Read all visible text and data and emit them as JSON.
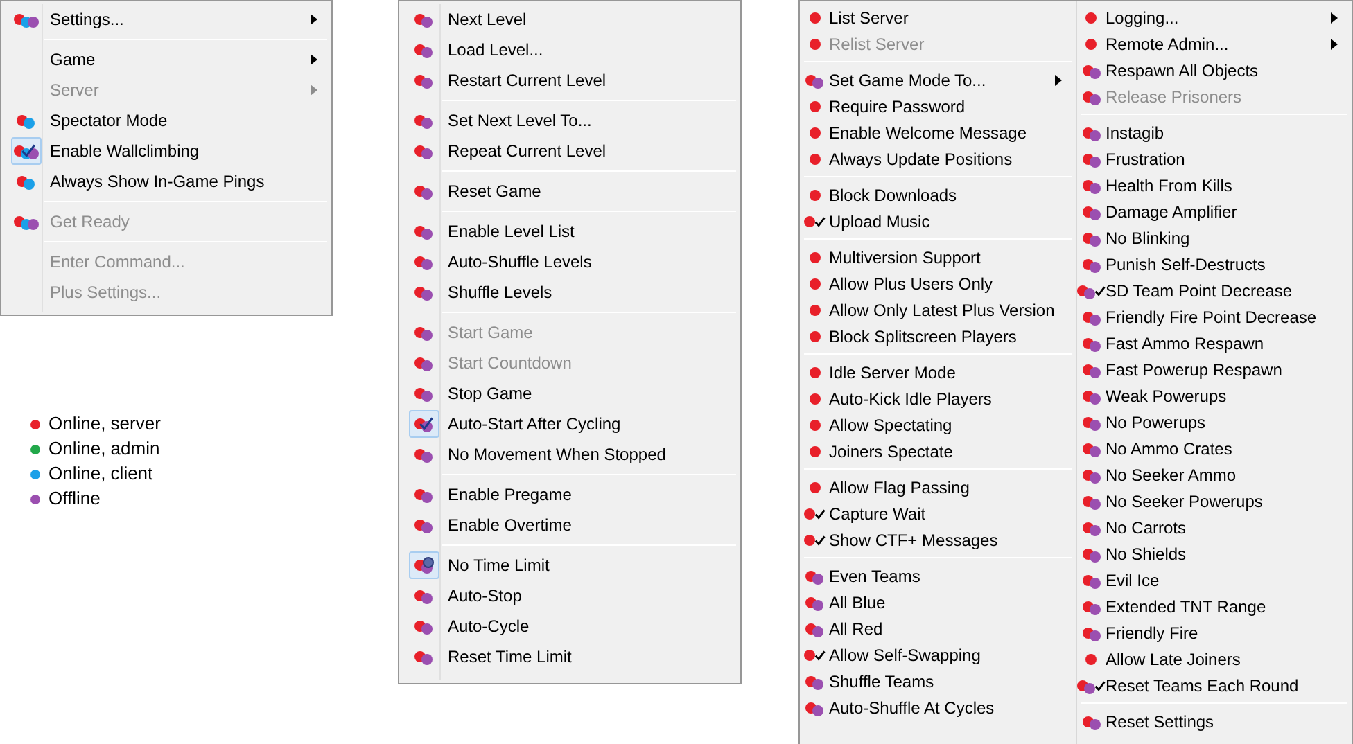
{
  "menus": [
    {
      "kind": "boxed",
      "columns": [
        {
          "sections": [
            [
              {
                "label": "Settings...",
                "dots": [
                  {
                    "color": "#e8202a"
                  },
                  {
                    "color": "#1ba0e8"
                  },
                  {
                    "color": "#9b4fb0"
                  }
                ],
                "checked": false,
                "disabled": false,
                "submenu": true
              }
            ],
            [
              {
                "label": "Game",
                "checked": false,
                "disabled": false,
                "submenu": true
              },
              {
                "label": "Server",
                "checked": false,
                "disabled": true,
                "submenu": true
              },
              {
                "label": "Spectator Mode",
                "dots": [
                  {
                    "color": "#e8202a"
                  },
                  {
                    "color": "#1ba0e8"
                  }
                ],
                "checked": false,
                "disabled": false,
                "submenu": false
              },
              {
                "label": "Enable Wallclimbing",
                "dots": [
                  {
                    "color": "#e8202a"
                  },
                  {
                    "color": "#1ba0e8"
                  },
                  {
                    "color": "#9b4fb0"
                  }
                ],
                "checked": true,
                "disabled": false,
                "submenu": false
              },
              {
                "label": "Always Show In-Game Pings",
                "dots": [
                  {
                    "color": "#e8202a"
                  },
                  {
                    "color": "#1ba0e8"
                  }
                ],
                "checked": false,
                "disabled": false,
                "submenu": false
              }
            ],
            [
              {
                "label": "Get Ready",
                "dots": [
                  {
                    "color": "#e8202a"
                  },
                  {
                    "color": "#1ba0e8"
                  },
                  {
                    "color": "#9b4fb0"
                  }
                ],
                "checked": false,
                "disabled": true,
                "submenu": false
              }
            ],
            [
              {
                "label": "Enter Command...",
                "checked": false,
                "disabled": true,
                "submenu": false
              },
              {
                "label": "Plus Settings...",
                "checked": false,
                "disabled": true,
                "submenu": false
              }
            ]
          ]
        }
      ]
    },
    {
      "kind": "boxed",
      "columns": [
        {
          "sections": [
            [
              {
                "label": "Next Level",
                "dots": [
                  {
                    "color": "#e8202a"
                  },
                  {
                    "color": "#9b4fb0"
                  }
                ],
                "checked": false,
                "disabled": false,
                "kind": "check"
              },
              {
                "label": "Load Level...",
                "dots": [
                  {
                    "color": "#e8202a"
                  },
                  {
                    "color": "#9b4fb0"
                  }
                ],
                "checked": false,
                "disabled": false,
                "kind": "check"
              },
              {
                "label": "Restart Current Level",
                "dots": [
                  {
                    "color": "#e8202a"
                  },
                  {
                    "color": "#9b4fb0"
                  }
                ],
                "checked": false,
                "disabled": false,
                "kind": "check"
              }
            ],
            [
              {
                "label": "Set Next Level To...",
                "dots": [
                  {
                    "color": "#e8202a"
                  },
                  {
                    "color": "#9b4fb0"
                  }
                ],
                "checked": false,
                "disabled": false,
                "kind": "check"
              },
              {
                "label": "Repeat Current Level",
                "dots": [
                  {
                    "color": "#e8202a"
                  },
                  {
                    "color": "#9b4fb0"
                  }
                ],
                "checked": false,
                "disabled": false,
                "kind": "check"
              }
            ],
            [
              {
                "label": "Reset Game",
                "dots": [
                  {
                    "color": "#e8202a"
                  },
                  {
                    "color": "#9b4fb0"
                  }
                ],
                "checked": false,
                "disabled": false,
                "kind": "check"
              }
            ],
            [
              {
                "label": "Enable Level List",
                "dots": [
                  {
                    "color": "#e8202a"
                  },
                  {
                    "color": "#9b4fb0"
                  }
                ],
                "checked": false,
                "disabled": false,
                "kind": "check"
              },
              {
                "label": "Auto-Shuffle Levels",
                "dots": [
                  {
                    "color": "#e8202a"
                  },
                  {
                    "color": "#9b4fb0"
                  }
                ],
                "checked": false,
                "disabled": false,
                "kind": "check"
              },
              {
                "label": "Shuffle Levels",
                "dots": [
                  {
                    "color": "#e8202a"
                  },
                  {
                    "color": "#9b4fb0"
                  }
                ],
                "checked": false,
                "disabled": false,
                "kind": "check"
              }
            ],
            [
              {
                "label": "Start Game",
                "dots": [
                  {
                    "color": "#e8202a"
                  },
                  {
                    "color": "#9b4fb0"
                  }
                ],
                "checked": false,
                "disabled": true,
                "kind": "check"
              },
              {
                "label": "Start Countdown",
                "dots": [
                  {
                    "color": "#e8202a"
                  },
                  {
                    "color": "#9b4fb0"
                  }
                ],
                "checked": false,
                "disabled": true,
                "kind": "check"
              },
              {
                "label": "Stop Game",
                "dots": [
                  {
                    "color": "#e8202a"
                  },
                  {
                    "color": "#9b4fb0"
                  }
                ],
                "checked": false,
                "disabled": false,
                "kind": "check"
              },
              {
                "label": "Auto-Start After Cycling",
                "dots": [
                  {
                    "color": "#e8202a"
                  },
                  {
                    "color": "#9b4fb0"
                  }
                ],
                "checked": true,
                "disabled": false,
                "kind": "check"
              },
              {
                "label": "No Movement When Stopped",
                "dots": [
                  {
                    "color": "#e8202a"
                  },
                  {
                    "color": "#9b4fb0"
                  }
                ],
                "checked": false,
                "disabled": false,
                "kind": "check"
              }
            ],
            [
              {
                "label": "Enable Pregame",
                "dots": [
                  {
                    "color": "#e8202a"
                  },
                  {
                    "color": "#9b4fb0"
                  }
                ],
                "checked": false,
                "disabled": false,
                "kind": "check"
              },
              {
                "label": "Enable Overtime",
                "dots": [
                  {
                    "color": "#e8202a"
                  },
                  {
                    "color": "#9b4fb0"
                  }
                ],
                "checked": false,
                "disabled": false,
                "kind": "check"
              }
            ],
            [
              {
                "label": "No Time Limit",
                "dots": [
                  {
                    "color": "#e8202a"
                  },
                  {
                    "color": "#9b4fb0"
                  }
                ],
                "checked": true,
                "disabled": false,
                "kind": "radio"
              },
              {
                "label": "Auto-Stop",
                "dots": [
                  {
                    "color": "#e8202a"
                  },
                  {
                    "color": "#9b4fb0"
                  }
                ],
                "checked": false,
                "disabled": false,
                "kind": "check"
              },
              {
                "label": "Auto-Cycle",
                "dots": [
                  {
                    "color": "#e8202a"
                  },
                  {
                    "color": "#9b4fb0"
                  }
                ],
                "checked": false,
                "disabled": false,
                "kind": "check"
              },
              {
                "label": "Reset Time Limit",
                "dots": [
                  {
                    "color": "#e8202a"
                  },
                  {
                    "color": "#9b4fb0"
                  }
                ],
                "checked": false,
                "disabled": false,
                "kind": "check"
              }
            ]
          ]
        }
      ]
    },
    {
      "kind": "plain",
      "columns": [
        {
          "sections": [
            [
              {
                "label": "List Server",
                "dots": [
                  {
                    "color": "#e8202a"
                  }
                ],
                "checked": false,
                "disabled": false,
                "submenu": false
              },
              {
                "label": "Relist Server",
                "dots": [
                  {
                    "color": "#e8202a"
                  }
                ],
                "checked": false,
                "disabled": true,
                "submenu": false
              }
            ],
            [
              {
                "label": "Set Game Mode To...",
                "dots": [
                  {
                    "color": "#e8202a"
                  },
                  {
                    "color": "#9b4fb0"
                  }
                ],
                "checked": false,
                "disabled": false,
                "submenu": true
              },
              {
                "label": "Require Password",
                "dots": [
                  {
                    "color": "#e8202a"
                  }
                ],
                "checked": false,
                "disabled": false,
                "submenu": false
              },
              {
                "label": "Enable Welcome Message",
                "dots": [
                  {
                    "color": "#e8202a"
                  }
                ],
                "checked": false,
                "disabled": false,
                "submenu": false
              },
              {
                "label": "Always Update Positions",
                "dots": [
                  {
                    "color": "#e8202a"
                  }
                ],
                "checked": false,
                "disabled": false,
                "submenu": false
              }
            ],
            [
              {
                "label": "Block Downloads",
                "dots": [
                  {
                    "color": "#e8202a"
                  }
                ],
                "checked": false,
                "disabled": false,
                "submenu": false
              },
              {
                "label": "Upload Music",
                "dots": [
                  {
                    "color": "#e8202a"
                  }
                ],
                "checked": true,
                "disabled": false,
                "submenu": false
              }
            ],
            [
              {
                "label": "Multiversion Support",
                "dots": [
                  {
                    "color": "#e8202a"
                  }
                ],
                "checked": false,
                "disabled": false,
                "submenu": false
              },
              {
                "label": "Allow Plus Users Only",
                "dots": [
                  {
                    "color": "#e8202a"
                  }
                ],
                "checked": false,
                "disabled": false,
                "submenu": false
              },
              {
                "label": "Allow Only Latest Plus Version",
                "dots": [
                  {
                    "color": "#e8202a"
                  }
                ],
                "checked": false,
                "disabled": false,
                "submenu": false
              },
              {
                "label": "Block Splitscreen Players",
                "dots": [
                  {
                    "color": "#e8202a"
                  }
                ],
                "checked": false,
                "disabled": false,
                "submenu": false
              }
            ],
            [
              {
                "label": "Idle Server Mode",
                "dots": [
                  {
                    "color": "#e8202a"
                  }
                ],
                "checked": false,
                "disabled": false,
                "submenu": false
              },
              {
                "label": "Auto-Kick Idle Players",
                "dots": [
                  {
                    "color": "#e8202a"
                  }
                ],
                "checked": false,
                "disabled": false,
                "submenu": false
              },
              {
                "label": "Allow Spectating",
                "dots": [
                  {
                    "color": "#e8202a"
                  }
                ],
                "checked": false,
                "disabled": false,
                "submenu": false
              },
              {
                "label": "Joiners Spectate",
                "dots": [
                  {
                    "color": "#e8202a"
                  }
                ],
                "checked": false,
                "disabled": false,
                "submenu": false
              }
            ],
            [
              {
                "label": "Allow Flag Passing",
                "dots": [
                  {
                    "color": "#e8202a"
                  }
                ],
                "checked": false,
                "disabled": false,
                "submenu": false
              },
              {
                "label": "Capture Wait",
                "dots": [
                  {
                    "color": "#e8202a"
                  }
                ],
                "checked": true,
                "disabled": false,
                "submenu": false
              },
              {
                "label": "Show CTF+ Messages",
                "dots": [
                  {
                    "color": "#e8202a"
                  }
                ],
                "checked": true,
                "disabled": false,
                "submenu": false
              }
            ],
            [
              {
                "label": "Even Teams",
                "dots": [
                  {
                    "color": "#e8202a"
                  },
                  {
                    "color": "#9b4fb0"
                  }
                ],
                "checked": false,
                "disabled": false,
                "submenu": false
              },
              {
                "label": "All Blue",
                "dots": [
                  {
                    "color": "#e8202a"
                  },
                  {
                    "color": "#9b4fb0"
                  }
                ],
                "checked": false,
                "disabled": false,
                "submenu": false
              },
              {
                "label": "All Red",
                "dots": [
                  {
                    "color": "#e8202a"
                  },
                  {
                    "color": "#9b4fb0"
                  }
                ],
                "checked": false,
                "disabled": false,
                "submenu": false
              },
              {
                "label": "Allow Self-Swapping",
                "dots": [
                  {
                    "color": "#e8202a"
                  }
                ],
                "checked": true,
                "disabled": false,
                "submenu": false
              },
              {
                "label": "Shuffle Teams",
                "dots": [
                  {
                    "color": "#e8202a"
                  },
                  {
                    "color": "#9b4fb0"
                  }
                ],
                "checked": false,
                "disabled": false,
                "submenu": false
              },
              {
                "label": "Auto-Shuffle At Cycles",
                "dots": [
                  {
                    "color": "#e8202a"
                  },
                  {
                    "color": "#9b4fb0"
                  }
                ],
                "checked": false,
                "disabled": false,
                "submenu": false
              }
            ]
          ]
        },
        {
          "sections": [
            [
              {
                "label": "Logging...",
                "dots": [
                  {
                    "color": "#e8202a"
                  }
                ],
                "checked": false,
                "disabled": false,
                "submenu": true
              },
              {
                "label": "Remote Admin...",
                "dots": [
                  {
                    "color": "#e8202a"
                  }
                ],
                "checked": false,
                "disabled": false,
                "submenu": true
              },
              {
                "label": "Respawn All Objects",
                "dots": [
                  {
                    "color": "#e8202a"
                  },
                  {
                    "color": "#9b4fb0"
                  }
                ],
                "checked": false,
                "disabled": false,
                "submenu": false
              },
              {
                "label": "Release Prisoners",
                "dots": [
                  {
                    "color": "#e8202a"
                  },
                  {
                    "color": "#9b4fb0"
                  }
                ],
                "checked": false,
                "disabled": true,
                "submenu": false
              }
            ],
            [
              {
                "label": "Instagib",
                "dots": [
                  {
                    "color": "#e8202a"
                  },
                  {
                    "color": "#9b4fb0"
                  }
                ],
                "checked": false,
                "disabled": false,
                "submenu": false
              },
              {
                "label": "Frustration",
                "dots": [
                  {
                    "color": "#e8202a"
                  },
                  {
                    "color": "#9b4fb0"
                  }
                ],
                "checked": false,
                "disabled": false,
                "submenu": false
              },
              {
                "label": "Health From Kills",
                "dots": [
                  {
                    "color": "#e8202a"
                  },
                  {
                    "color": "#9b4fb0"
                  }
                ],
                "checked": false,
                "disabled": false,
                "submenu": false
              },
              {
                "label": "Damage Amplifier",
                "dots": [
                  {
                    "color": "#e8202a"
                  },
                  {
                    "color": "#9b4fb0"
                  }
                ],
                "checked": false,
                "disabled": false,
                "submenu": false
              },
              {
                "label": "No Blinking",
                "dots": [
                  {
                    "color": "#e8202a"
                  },
                  {
                    "color": "#9b4fb0"
                  }
                ],
                "checked": false,
                "disabled": false,
                "submenu": false
              },
              {
                "label": "Punish Self-Destructs",
                "dots": [
                  {
                    "color": "#e8202a"
                  },
                  {
                    "color": "#9b4fb0"
                  }
                ],
                "checked": false,
                "disabled": false,
                "submenu": false
              },
              {
                "label": "SD Team Point Decrease",
                "dots": [
                  {
                    "color": "#e8202a"
                  },
                  {
                    "color": "#9b4fb0"
                  }
                ],
                "checked": true,
                "disabled": false,
                "submenu": false
              },
              {
                "label": "Friendly Fire Point Decrease",
                "dots": [
                  {
                    "color": "#e8202a"
                  },
                  {
                    "color": "#9b4fb0"
                  }
                ],
                "checked": false,
                "disabled": false,
                "submenu": false
              },
              {
                "label": "Fast Ammo Respawn",
                "dots": [
                  {
                    "color": "#e8202a"
                  },
                  {
                    "color": "#9b4fb0"
                  }
                ],
                "checked": false,
                "disabled": false,
                "submenu": false
              },
              {
                "label": "Fast Powerup Respawn",
                "dots": [
                  {
                    "color": "#e8202a"
                  },
                  {
                    "color": "#9b4fb0"
                  }
                ],
                "checked": false,
                "disabled": false,
                "submenu": false
              },
              {
                "label": "Weak Powerups",
                "dots": [
                  {
                    "color": "#e8202a"
                  },
                  {
                    "color": "#9b4fb0"
                  }
                ],
                "checked": false,
                "disabled": false,
                "submenu": false
              },
              {
                "label": "No Powerups",
                "dots": [
                  {
                    "color": "#e8202a"
                  },
                  {
                    "color": "#9b4fb0"
                  }
                ],
                "checked": false,
                "disabled": false,
                "submenu": false
              },
              {
                "label": "No Ammo Crates",
                "dots": [
                  {
                    "color": "#e8202a"
                  },
                  {
                    "color": "#9b4fb0"
                  }
                ],
                "checked": false,
                "disabled": false,
                "submenu": false
              },
              {
                "label": "No Seeker Ammo",
                "dots": [
                  {
                    "color": "#e8202a"
                  },
                  {
                    "color": "#9b4fb0"
                  }
                ],
                "checked": false,
                "disabled": false,
                "submenu": false
              },
              {
                "label": "No Seeker Powerups",
                "dots": [
                  {
                    "color": "#e8202a"
                  },
                  {
                    "color": "#9b4fb0"
                  }
                ],
                "checked": false,
                "disabled": false,
                "submenu": false
              },
              {
                "label": "No Carrots",
                "dots": [
                  {
                    "color": "#e8202a"
                  },
                  {
                    "color": "#9b4fb0"
                  }
                ],
                "checked": false,
                "disabled": false,
                "submenu": false
              },
              {
                "label": "No Shields",
                "dots": [
                  {
                    "color": "#e8202a"
                  },
                  {
                    "color": "#9b4fb0"
                  }
                ],
                "checked": false,
                "disabled": false,
                "submenu": false
              },
              {
                "label": "Evil Ice",
                "dots": [
                  {
                    "color": "#e8202a"
                  },
                  {
                    "color": "#9b4fb0"
                  }
                ],
                "checked": false,
                "disabled": false,
                "submenu": false
              },
              {
                "label": "Extended TNT Range",
                "dots": [
                  {
                    "color": "#e8202a"
                  },
                  {
                    "color": "#9b4fb0"
                  }
                ],
                "checked": false,
                "disabled": false,
                "submenu": false
              },
              {
                "label": "Friendly Fire",
                "dots": [
                  {
                    "color": "#e8202a"
                  },
                  {
                    "color": "#9b4fb0"
                  }
                ],
                "checked": false,
                "disabled": false,
                "submenu": false
              },
              {
                "label": "Allow Late Joiners",
                "dots": [
                  {
                    "color": "#e8202a"
                  }
                ],
                "checked": false,
                "disabled": false,
                "submenu": false
              },
              {
                "label": "Reset Teams Each Round",
                "dots": [
                  {
                    "color": "#e8202a"
                  },
                  {
                    "color": "#9b4fb0"
                  }
                ],
                "checked": true,
                "disabled": false,
                "submenu": false
              }
            ],
            [
              {
                "label": "Reset Settings",
                "dots": [
                  {
                    "color": "#e8202a"
                  },
                  {
                    "color": "#9b4fb0"
                  }
                ],
                "checked": false,
                "disabled": false,
                "submenu": false
              }
            ]
          ]
        }
      ]
    }
  ],
  "legend": [
    {
      "label": "Online, server",
      "color": "#e8202a"
    },
    {
      "label": "Online, admin",
      "color": "#22a84a"
    },
    {
      "label": "Online, client",
      "color": "#1ba0e8"
    },
    {
      "label": "Offline",
      "color": "#9b4fb0"
    }
  ]
}
